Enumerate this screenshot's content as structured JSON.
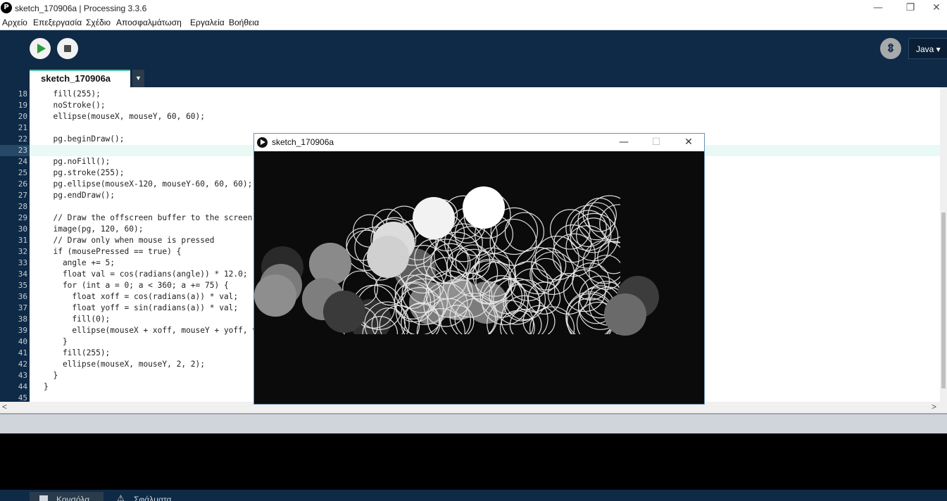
{
  "window": {
    "title": "sketch_170906a | Processing 3.3.6",
    "app_icon_glyph": "P",
    "minimize_glyph": "—",
    "maximize_glyph": "❐",
    "close_glyph": "✕"
  },
  "menu": {
    "items": [
      "Αρχείο",
      "Επεξεργασία",
      "Σχέδιο",
      "Αποσφαλμάτωση",
      "Εργαλεία",
      "Βοήθεια"
    ]
  },
  "toolbar": {
    "run_icon": "play-icon",
    "stop_icon": "stop-icon",
    "debug_glyph": "ꗊ",
    "mode_label": "Java ▾"
  },
  "tabs": {
    "active_label": "sketch_170906a",
    "menu_glyph": "▼"
  },
  "editor": {
    "line_numbers": [
      "18",
      "19",
      "20",
      "21",
      "22",
      "23",
      "24",
      "25",
      "26",
      "27",
      "28",
      "29",
      "30",
      "31",
      "32",
      "33",
      "34",
      "35",
      "36",
      "37",
      "38",
      "39",
      "40",
      "41",
      "42",
      "43",
      "44",
      "45"
    ],
    "current_line": "23",
    "lines": [
      "  fill(255);",
      "  noStroke();",
      "  ellipse(mouseX, mouseY, 60, 60);",
      "",
      "  pg.beginDraw();",
      "",
      "  pg.noFill();",
      "  pg.stroke(255);",
      "  pg.ellipse(mouseX-120, mouseY-60, 60, 60);",
      "  pg.endDraw();",
      "",
      "  // Draw the offscreen buffer to the screen",
      "  image(pg, 120, 60);",
      "  // Draw only when mouse is pressed",
      "  if (mousePressed == true) {",
      "    angle += 5;",
      "    float val = cos(radians(angle)) * 12.0;",
      "    for (int a = 0; a < 360; a += 75) {",
      "      float xoff = cos(radians(a)) * val;",
      "      float yoff = sin(radians(a)) * val;",
      "      fill(0);",
      "      ellipse(mouseX + xoff, mouseY + yoff, v",
      "    }",
      "    fill(255);",
      "    ellipse(mouseX, mouseY, 2, 2);",
      "  }",
      "}",
      ""
    ]
  },
  "scrollbars": {
    "left_arrow": "<",
    "right_arrow": ">"
  },
  "sketch_window": {
    "title": "sketch_170906a",
    "minimize_glyph": "—",
    "maximize_glyph": "☐",
    "close_glyph": "✕"
  },
  "footer": {
    "console_label": "Κονσόλα",
    "errors_label": "Σφάλματα"
  },
  "colors": {
    "toolbar_bg": "#0e2a47",
    "tab_accent": "#5ac7a3",
    "run_green": "#2a9d3a",
    "current_line": "#e8f9f6"
  }
}
